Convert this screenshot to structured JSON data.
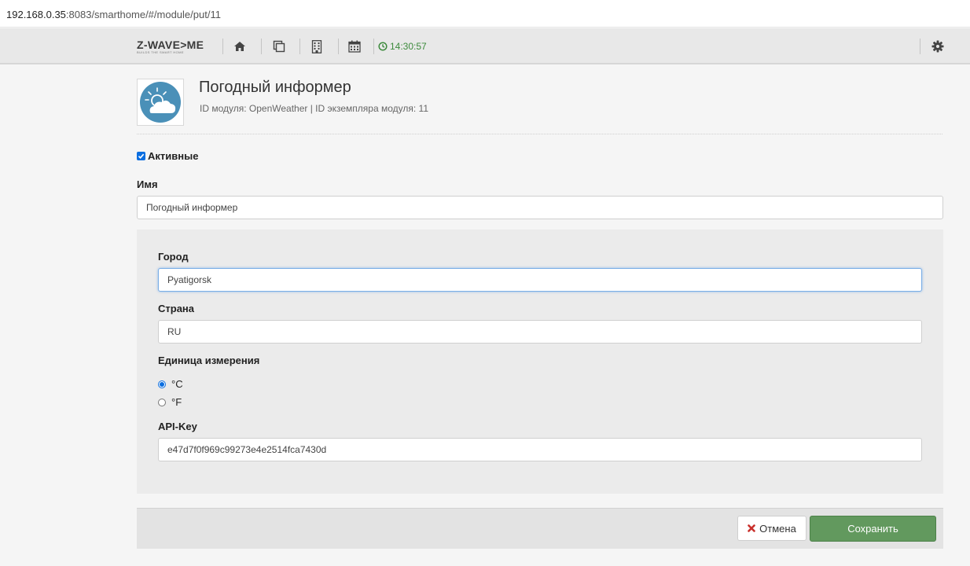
{
  "browser": {
    "url_host": "192.168.0.35",
    "url_rest": ":8083/smarthome/#/module/put/11"
  },
  "navbar": {
    "logo_text": "Z-WAVE>ME",
    "logo_tagline": "BUILDS THE SMART HOME",
    "clock": "14:30:57",
    "icons": [
      "home-icon",
      "copy-icon",
      "building-icon",
      "calendar-icon",
      "clock-icon",
      "gear-icon"
    ]
  },
  "module": {
    "title": "Погодный информер",
    "subtitle": "ID модуля: OpenWeather | ID экземпляра модуля: 11",
    "icon": "weather-cloud-icon"
  },
  "form": {
    "active_label": "Активные",
    "active_checked": true,
    "name_label": "Имя",
    "name_value": "Погодный информер",
    "city_label": "Город",
    "city_value": "Pyatigorsk",
    "country_label": "Страна",
    "country_value": "RU",
    "unit_label": "Единица измерения",
    "unit_options": [
      {
        "label": "°C",
        "checked": true
      },
      {
        "label": "°F",
        "checked": false
      }
    ],
    "apikey_label": "API-Key",
    "apikey_value": "e47d7f0f969c99273e4e2514fca7430d"
  },
  "buttons": {
    "cancel": "Отмена",
    "save": "Сохранить"
  },
  "colors": {
    "accent": "#0b6ee0",
    "save": "#62995e",
    "cancel_icon": "#c9302c",
    "clock": "#3c8a3c"
  }
}
